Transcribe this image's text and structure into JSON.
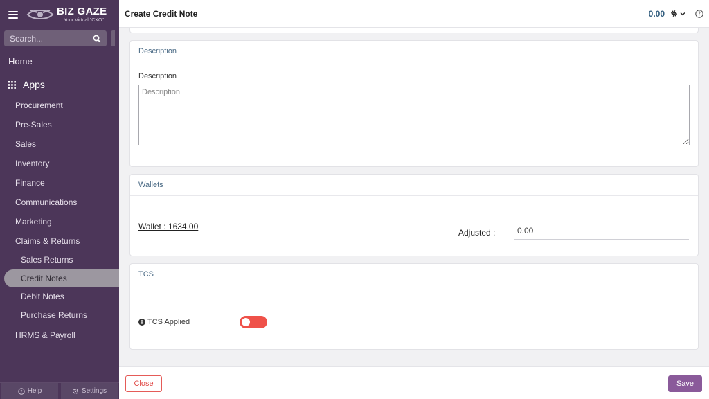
{
  "sidebar": {
    "logo_name": "BIZ GAZE",
    "logo_tagline": "Your Virtual \"CXO\"",
    "search_placeholder": "Search...",
    "home": "Home",
    "apps": "Apps",
    "items": [
      {
        "label": "Procurement"
      },
      {
        "label": "Pre-Sales"
      },
      {
        "label": "Sales"
      },
      {
        "label": "Inventory"
      },
      {
        "label": "Finance"
      },
      {
        "label": "Communications"
      },
      {
        "label": "Marketing"
      },
      {
        "label": "Claims & Returns"
      }
    ],
    "sub_items": [
      {
        "label": "Sales Returns",
        "active": false
      },
      {
        "label": "Credit Notes",
        "active": true
      },
      {
        "label": "Debit Notes",
        "active": false
      },
      {
        "label": "Purchase Returns",
        "active": false
      }
    ],
    "after_item": "HRMS & Payroll",
    "help": "Help",
    "settings": "Settings"
  },
  "header": {
    "title": "Create Credit Note",
    "amount": "0.00"
  },
  "description_card": {
    "heading": "Description",
    "field_label": "Description",
    "placeholder": "Description",
    "value": ""
  },
  "wallets_card": {
    "heading": "Wallets",
    "wallet_link": "Wallet : 1634.00",
    "adjusted_label": "Adjusted :",
    "adjusted_value": "0.00"
  },
  "tcs_card": {
    "heading": "TCS",
    "label": "TCS Applied",
    "enabled": false
  },
  "footer": {
    "close_label": "Close",
    "save_label": "Save"
  },
  "colors": {
    "sidebar_bg": "#4c3659",
    "active_item_bg": "#9c97a0",
    "accent": "#8a5a9a",
    "toggle_off": "#ef5149",
    "header_amount": "#2f5b7c"
  }
}
